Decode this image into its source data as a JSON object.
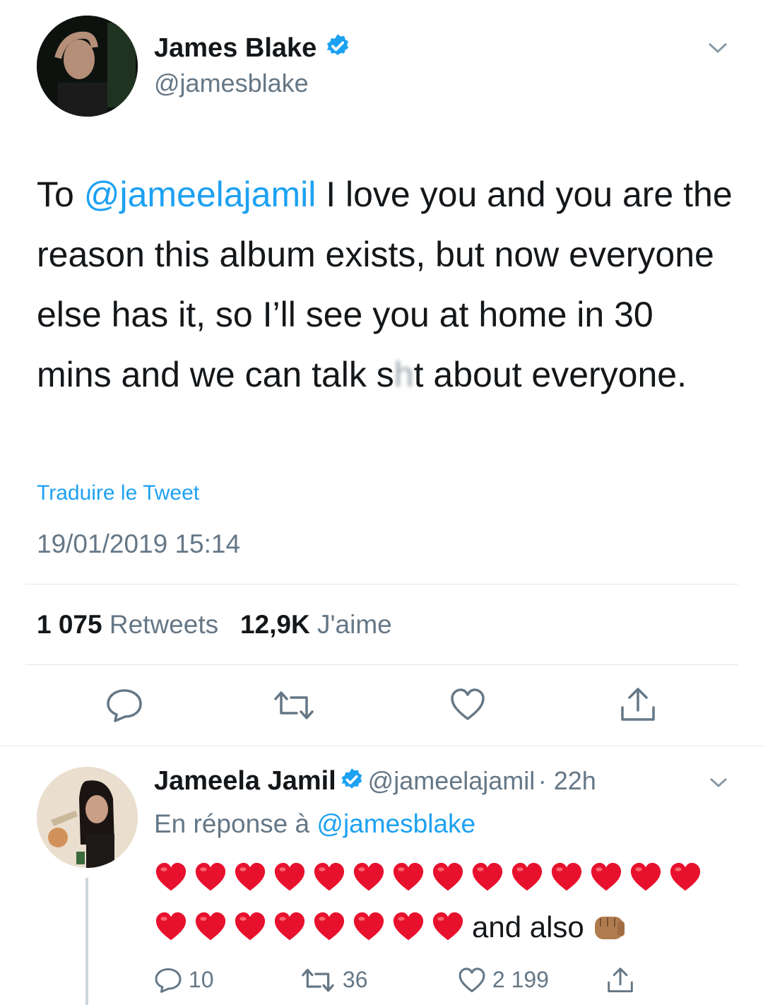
{
  "tweet": {
    "author_name": "James Blake",
    "author_handle": "@jamesblake",
    "text_parts": [
      "To ",
      "@jameelajamil",
      " I love you and you are the reason this album exists, but now everyone else has it, so I’ll see you at home in 30 mins and we can talk s",
      "h",
      "t about everyone."
    ],
    "translate_label": "Traduire le Tweet",
    "timestamp": "19/01/2019 15:14",
    "retweets_count": "1 075",
    "retweets_label": "Retweets",
    "likes_count": "12,9K",
    "likes_label": "J'aime"
  },
  "reply": {
    "author_name": "Jameela Jamil",
    "author_handle": "@jameelajamil",
    "time": "· 22h",
    "in_reply_prefix": "En réponse à",
    "in_reply_handle": "@jamesblake",
    "hearts_row1": 14,
    "hearts_row2": 8,
    "tail_text": "and also",
    "reply_count": "10",
    "retweet_count": "36",
    "like_count": "2 199"
  },
  "colors": {
    "accent": "#1da1f2",
    "muted": "#657786",
    "heart": "#e0245e"
  }
}
